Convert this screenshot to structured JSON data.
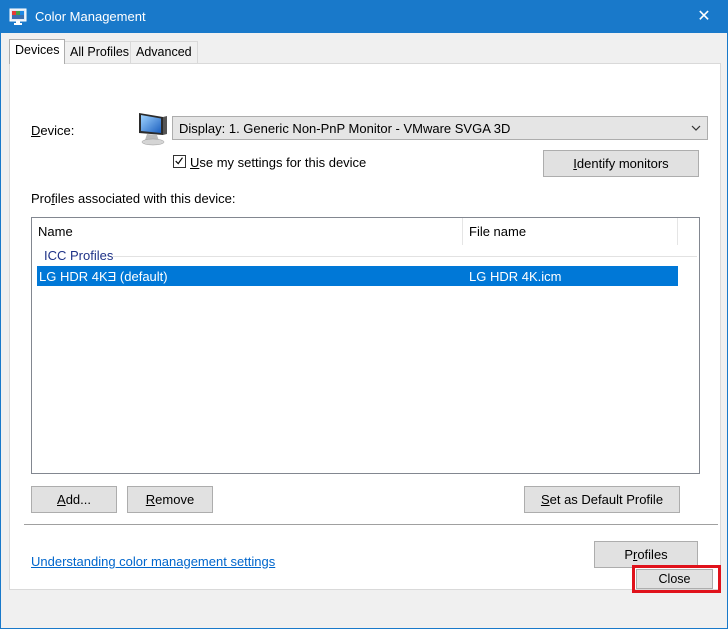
{
  "window": {
    "title": "Color Management",
    "close_glyph": "✕"
  },
  "tabs": [
    {
      "label": "Devices",
      "active": true
    },
    {
      "label": "All Profiles",
      "active": false
    },
    {
      "label": "Advanced",
      "active": false
    }
  ],
  "device": {
    "label_accel": "D",
    "label_rest": "evice:",
    "selected": "Display: 1. Generic Non-PnP Monitor - VMware SVGA 3D",
    "use_settings_accel": "U",
    "use_settings_rest": "se my settings for this device",
    "use_settings_checked": true,
    "identify_accel": "I",
    "identify_rest": "dentify monitors"
  },
  "profiles_section": {
    "label_pre": "Pro",
    "label_accel": "f",
    "label_post": "iles associated with this device:",
    "columns": [
      "Name",
      "File name"
    ],
    "group": "ICC Profiles",
    "rows": [
      {
        "name": "LG HDR 4KƎ  (default)",
        "file": "LG HDR 4K.icm",
        "selected": true
      }
    ]
  },
  "buttons": {
    "add_accel": "A",
    "add_rest": "dd...",
    "remove_accel": "R",
    "remove_rest": "emove",
    "set_default_accel": "S",
    "set_default_rest": "et as Default Profile",
    "profiles_pre": "P",
    "profiles_accel": "r",
    "profiles_post": "ofiles",
    "close": "Close"
  },
  "link": "Understanding color management settings",
  "colors": {
    "titlebar": "#1979ca",
    "selection": "#0078d7",
    "highlight_border": "#e0121b",
    "link": "#0066cc"
  }
}
